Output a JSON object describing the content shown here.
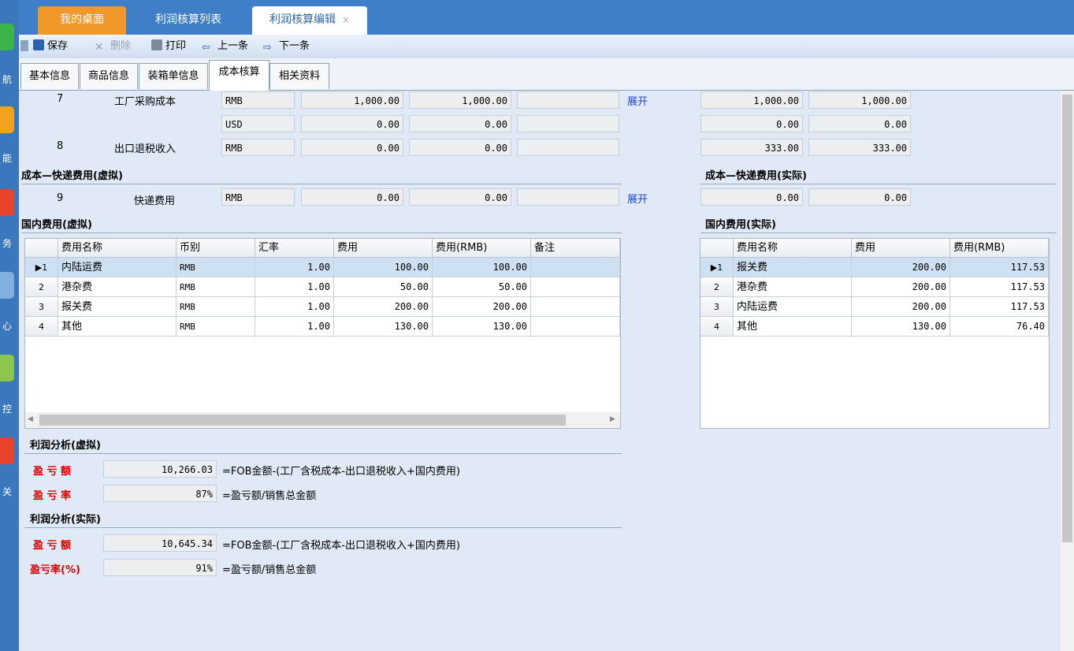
{
  "rail": {
    "chars": [
      "航",
      "能",
      "务",
      "心",
      "控",
      "关"
    ]
  },
  "top_tabs": {
    "desk": "我的桌面",
    "list": "利润核算列表",
    "edit": "利润核算编辑",
    "close": "×"
  },
  "toolbar": {
    "save": "保存",
    "delete": "删除",
    "print": "打印",
    "prev": "上一条",
    "next": "下一条"
  },
  "inner_tabs": [
    "基本信息",
    "商品信息",
    "装箱单信息",
    "成本核算",
    "相关资料"
  ],
  "cost_rows": [
    {
      "no": "7",
      "name": "工厂采购成本",
      "currency": "RMB",
      "v1": "1,000.00",
      "v2": "1,000.00",
      "v3": "",
      "link": "展开",
      "a1": "1,000.00",
      "a2": "1,000.00"
    },
    {
      "no": "",
      "name": "",
      "currency": "USD",
      "v1": "0.00",
      "v2": "0.00",
      "v3": "",
      "link": "",
      "a1": "0.00",
      "a2": "0.00"
    },
    {
      "no": "8",
      "name": "出口退税收入",
      "currency": "RMB",
      "v1": "0.00",
      "v2": "0.00",
      "v3": "",
      "link": "",
      "a1": "333.00",
      "a2": "333.00"
    }
  ],
  "express": {
    "title_virtual": "成本—快递费用(虚拟)",
    "title_actual": "成本—快递费用(实际)",
    "no": "9",
    "name": "快递费用",
    "currency": "RMB",
    "v1": "0.00",
    "v2": "0.00",
    "v3": "",
    "link": "展开",
    "a1": "0.00",
    "a2": "0.00"
  },
  "domestic_virtual": {
    "title": "国内费用(虚拟)",
    "headers": [
      "费用名称",
      "币别",
      "汇率",
      "费用",
      "费用(RMB)",
      "备注"
    ],
    "rows": [
      {
        "n": "1",
        "name": "内陆运费",
        "cur": "RMB",
        "rate": "1.00",
        "fee": "100.00",
        "rmb": "100.00",
        "note": ""
      },
      {
        "n": "2",
        "name": "港杂费",
        "cur": "RMB",
        "rate": "1.00",
        "fee": "50.00",
        "rmb": "50.00",
        "note": ""
      },
      {
        "n": "3",
        "name": "报关费",
        "cur": "RMB",
        "rate": "1.00",
        "fee": "200.00",
        "rmb": "200.00",
        "note": ""
      },
      {
        "n": "4",
        "name": "其他",
        "cur": "RMB",
        "rate": "1.00",
        "fee": "130.00",
        "rmb": "130.00",
        "note": ""
      }
    ]
  },
  "domestic_actual": {
    "title": "国内费用(实际)",
    "headers": [
      "费用名称",
      "费用",
      "费用(RMB)"
    ],
    "rows": [
      {
        "n": "1",
        "name": "报关费",
        "fee": "200.00",
        "rmb": "117.53"
      },
      {
        "n": "2",
        "name": "港杂费",
        "fee": "200.00",
        "rmb": "117.53"
      },
      {
        "n": "3",
        "name": "内陆运费",
        "fee": "200.00",
        "rmb": "117.53"
      },
      {
        "n": "4",
        "name": "其他",
        "fee": "130.00",
        "rmb": "76.40"
      }
    ]
  },
  "profit_virtual": {
    "title": "利润分析(虚拟)",
    "amount_label": "盈 亏 额",
    "amount": "10,266.03",
    "amount_formula": "=FOB金额-(工厂含税成本-出口退税收入+国内费用)",
    "rate_label": "盈 亏 率",
    "rate": "87%",
    "rate_formula": "=盈亏额/销售总金额"
  },
  "profit_actual": {
    "title": "利润分析(实际)",
    "amount_label": "盈 亏 额",
    "amount": "10,645.34",
    "amount_formula": "=FOB金额-(工厂含税成本-出口退税收入+国内费用)",
    "rate_label": "盈亏率(%)",
    "rate": "91%",
    "rate_formula": "=盈亏额/销售总金额"
  },
  "colors": {
    "rail": "#3b77bd",
    "tabbar": "#3f7fc8",
    "desk_tab": "#f0982a",
    "content_bg": "#dfeaf6",
    "link": "#1f3fd6",
    "profit_label": "#e00000"
  }
}
